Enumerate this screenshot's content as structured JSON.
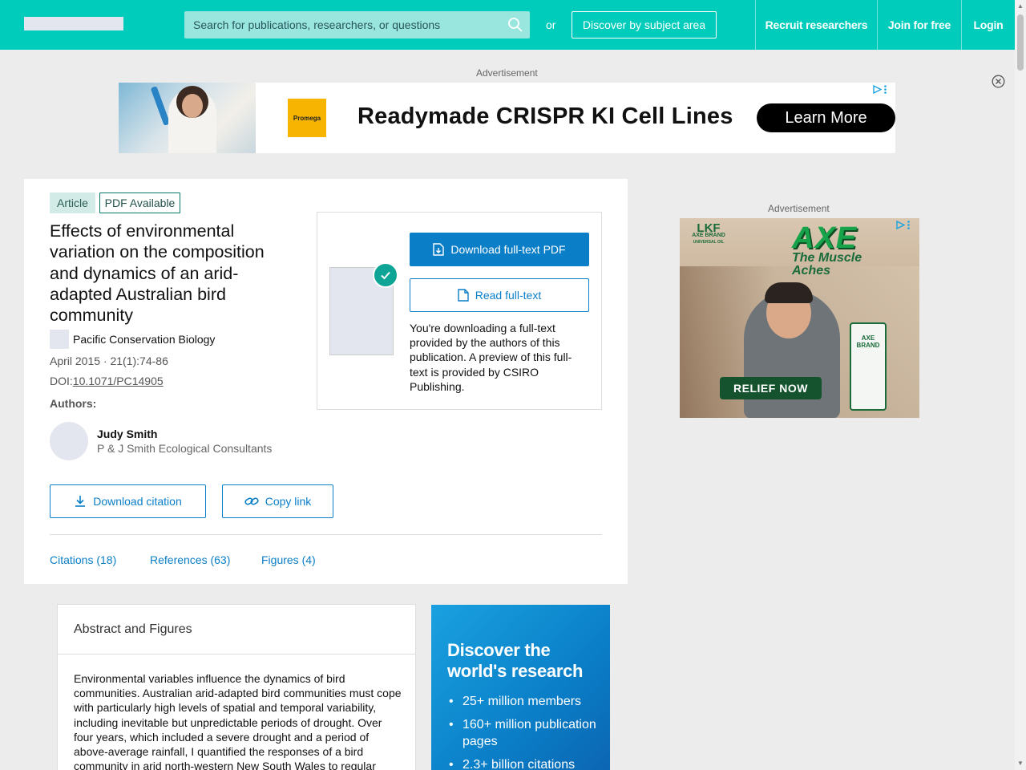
{
  "header": {
    "search_placeholder": "Search for publications, researchers, or questions",
    "or_text": "or",
    "discover_label": "Discover by subject area",
    "nav": [
      "Recruit researchers",
      "Join for free",
      "Login"
    ],
    "brand_color": "#00ccbb"
  },
  "top_ad": {
    "label": "Advertisement",
    "brand": "Promega",
    "headline": "Readymade CRISPR KI Cell Lines",
    "cta": "Learn More"
  },
  "article": {
    "tags": [
      "Article",
      "PDF Available"
    ],
    "title": "Effects of environmental variation on the composition and dynamics of an arid-adapted Australian bird community",
    "journal": "Pacific Conservation Biology",
    "date_volume": "April 2015 · 21(1):74-86",
    "doi_prefix": "DOI:",
    "doi": "10.1071/PC14905",
    "authors_label": "Authors:",
    "authors": [
      {
        "name": "Judy Smith",
        "affiliation": "P & J Smith Ecological Consultants"
      }
    ],
    "download_citation": "Download citation",
    "copy_link": "Copy link",
    "tabs": [
      "Citations (18)",
      "References (63)",
      "Figures (4)"
    ]
  },
  "download_panel": {
    "primary": "Download full-text PDF",
    "secondary": "Read full-text",
    "note": "You're downloading a full-text provided by the authors of this publication. A preview of this full-text is provided by CSIRO Publishing."
  },
  "side_ad": {
    "label": "Advertisement",
    "brand_top": "LKF",
    "brand_name": "AXE BRAND",
    "brand_sub": "UNIVERSAL OIL",
    "product": "AXE",
    "tagline_1": "The",
    "tagline_2": "Muscle",
    "tagline_3": "Aches",
    "bottle_label": "AXE BRAND",
    "cta": "RELIEF NOW"
  },
  "abstract": {
    "heading": "Abstract and Figures",
    "text": "Environmental variables influence the dynamics of bird communities. Australian arid-adapted bird communities must cope with particularly high levels of spatial and temporal variability, including inevitable but unpredictable periods of drought. Over four years, which included a severe drought and a period of above-average rainfall, I quantified the responses of a bird community in arid north-western New South Wales to regular"
  },
  "promo": {
    "title": "Discover the world's research",
    "items": [
      "25+ million members",
      "160+ million publication pages",
      "2.3+ billion citations"
    ]
  }
}
